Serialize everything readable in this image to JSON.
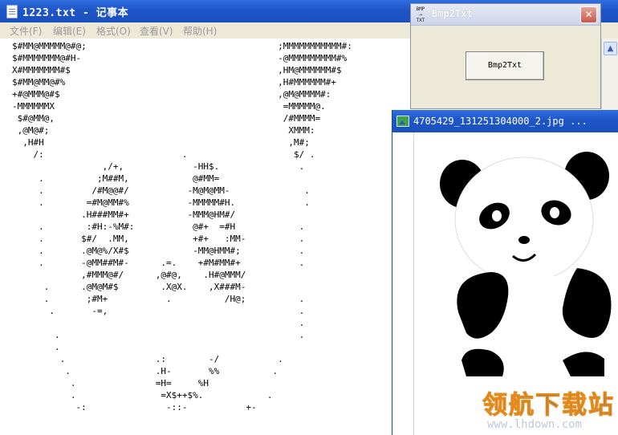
{
  "notepad": {
    "title": "1223.txt - 记事本",
    "menu": [
      "文件(F)",
      "编辑(E)",
      "格式(O)",
      "查看(V)",
      "帮助(H)"
    ],
    "content": "$#MM@MMMMM@#@;                                    ;MMMMMMMMMMM#:\n$#MMMMMMM@#H-                                     -@MMMMMMMMM#%\nX#MMMMMMM#$                                       ,HM@MMMMMM#$\n$#MM@MM@#%                                        ,H#MMMMMM#+\n+#@MMM@#$                                         ,@M@MMMM#:\n-MMMMMMX                                           =MMMMM@.\n $#@MM@,                                           /#MMMM=\n ,@M@#;                                             XMMM:\n  ,H#H                                              ,M#;\n    /:                          .                    $/ .\n                 ,/+,             -HH$.               .\n     .          ;M##M,            @#MM=\n     .         /#M@@#/           -M@M@MM-              .\n     .        =#M@MM#%           -MMMMM#H.             .\n             .H###MM#+           -MMM@HM#/\n     .        :#H:-%M#:           @#+  =#H            .\n     .       $#/  .MM,            +#+   :MM-          .\n     .       .@M@%/X#$            -MM@HMM#;           .\n     .       -@MM##M#-      .=.    +#M#MM#+           .\n             ,#MMM@#/      ,@#@,    .H#@MMM/\n      .      .@M@M#$        .X@X.    ,X###M-\n      .       ;#M+           .          /H@;          .\n       .       -=,                                    .\n                                                      .\n        .                                             .\n        .\n         .                 .:        -/           .\n          .                .H-       %%          .\n           .               =H=     %H\n           .                =X$++$%.            .\n            -:               -::-           +-"
  },
  "bmp2txt": {
    "title": "Bmp2Txt",
    "icon_text": "BMP → TXT",
    "button_label": "Bmp2Txt",
    "close_symbol": "✕"
  },
  "viewer": {
    "title": "4705429_131251304000_2.jpg ..."
  },
  "watermark": {
    "main": "领航下载站",
    "url": "www.lhdown.com"
  },
  "colors": {
    "titlebar": "#1f56c7",
    "chrome": "#ece9d8",
    "close": "#c8584a"
  }
}
